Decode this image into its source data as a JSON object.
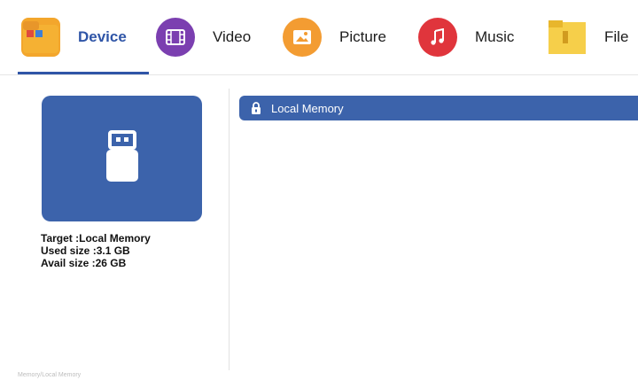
{
  "tabs": [
    {
      "label": "Device",
      "icon": "device-folder-icon",
      "color": "#f3a62c",
      "active": true
    },
    {
      "label": "Video",
      "icon": "video-film-icon",
      "color": "#7b3fb0",
      "active": false
    },
    {
      "label": "Picture",
      "icon": "picture-image-icon",
      "color": "#f39c32",
      "active": false
    },
    {
      "label": "Music",
      "icon": "music-note-icon",
      "color": "#e0353c",
      "active": false
    },
    {
      "label": "File",
      "icon": "file-folder-icon",
      "color": "#f3c23a",
      "active": false
    }
  ],
  "device": {
    "icon": "usb-drive-icon",
    "target": "Target :Local Memory",
    "used": "Used size :3.1 GB",
    "avail": "Avail size :26 GB"
  },
  "path": {
    "label": "Local Memory",
    "icon": "lock-icon"
  },
  "footer": {
    "text": "Memory/Local Memory"
  },
  "colors": {
    "accent": "#2f55a7",
    "card": "#3c63ab"
  }
}
